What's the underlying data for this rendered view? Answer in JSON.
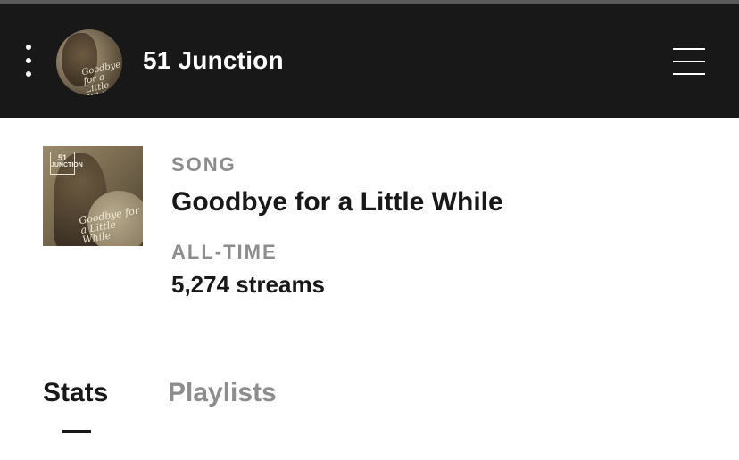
{
  "header": {
    "artist_name": "51 Junction",
    "avatar_script": "Goodbye for a Little While",
    "colors": {
      "background": "#181818",
      "text": "#ffffff"
    },
    "icons": {
      "more": "vertical-dots-icon",
      "menu": "hamburger-menu-icon"
    }
  },
  "song": {
    "type_label": "SONG",
    "title": "Goodbye for a Little While",
    "period_label": "ALL-TIME",
    "streams": "5,274 streams",
    "cover": {
      "badge_number": "51",
      "badge_text": "JUNCTION",
      "script": "Goodbye for a Little While"
    }
  },
  "tabs": [
    {
      "label": "Stats",
      "active": true
    },
    {
      "label": "Playlists",
      "active": false
    }
  ],
  "colors": {
    "secondary_text": "#8d8d8d",
    "primary_text": "#181818",
    "page_background": "#ffffff"
  }
}
